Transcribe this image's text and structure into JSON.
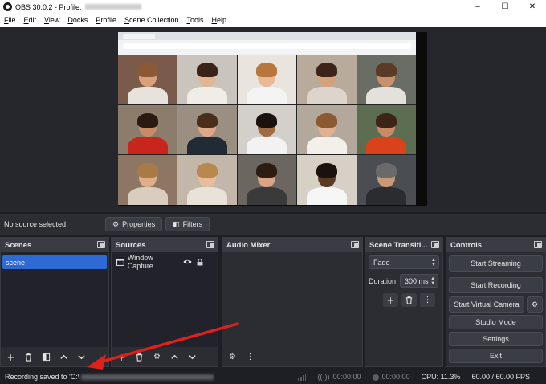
{
  "window": {
    "title": "OBS 30.0.2 - Profile:",
    "controls": {
      "minimize": "–",
      "maximize": "☐",
      "close": "✕"
    }
  },
  "menu": [
    "File",
    "Edit",
    "View",
    "Docks",
    "Profile",
    "Scene Collection",
    "Tools",
    "Help"
  ],
  "sourcebar": {
    "no_source": "No source selected",
    "properties_label": "Properties",
    "filters_label": "Filters"
  },
  "scenes": {
    "title": "Scenes",
    "items": [
      "scene"
    ]
  },
  "sources": {
    "title": "Sources",
    "items": [
      {
        "name": "Window Capture"
      }
    ]
  },
  "audio_mixer": {
    "title": "Audio Mixer"
  },
  "scene_transitions": {
    "title": "Scene Transiti...",
    "transition": "Fade",
    "duration_label": "Duration",
    "duration_value": "300 ms"
  },
  "controls": {
    "title": "Controls",
    "start_streaming": "Start Streaming",
    "start_recording": "Start Recording",
    "start_virtual_camera": "Start Virtual Camera",
    "studio_mode": "Studio Mode",
    "settings": "Settings",
    "exit": "Exit"
  },
  "status": {
    "recording_saved": "Recording saved to 'C:\\",
    "stream_time": "00:00:00",
    "record_time": "00:00:00",
    "cpu": "CPU: 11.3%",
    "fps": "60.00 / 60.00 FPS"
  },
  "colors": {
    "accent": "#2d6ad6",
    "annotation_arrow": "#e0201b"
  },
  "icons": {
    "gear": "gear-icon",
    "filter": "filter-icon",
    "eye": "eye-icon",
    "lock": "lock-icon"
  }
}
